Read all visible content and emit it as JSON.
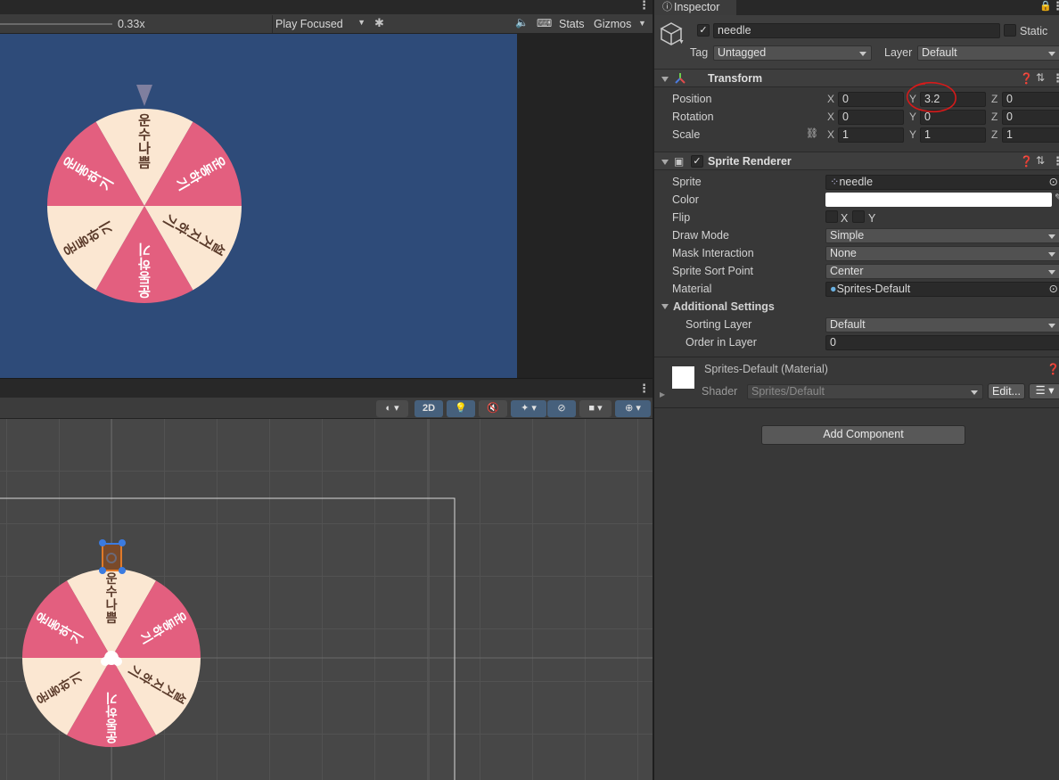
{
  "game_toolbar": {
    "scale_value": "0.33x",
    "play_mode": "Play Focused",
    "stats_label": "Stats",
    "gizmos_label": "Gizmos"
  },
  "wheel": {
    "segments": [
      {
        "text": "운수나쁨",
        "color": "#fbe7d2"
      },
      {
        "text": "운동하기",
        "color": "#e35f7f"
      },
      {
        "text": "설거지하기",
        "color": "#fbe7d2"
      },
      {
        "text": "운동하기",
        "color": "#e35f7f"
      },
      {
        "text": "운동하기",
        "color": "#fbe7d2"
      },
      {
        "text": "운동하기",
        "color": "#e35f7f"
      }
    ],
    "needle_color": "#7f7f9f"
  },
  "scene_toolbar": {
    "mode_2d": "2D"
  },
  "inspector": {
    "tab_label": "Inspector",
    "object_name": "needle",
    "static_label": "Static",
    "tag_label": "Tag",
    "tag_value": "Untagged",
    "layer_label": "Layer",
    "layer_value": "Default",
    "transform": {
      "title": "Transform",
      "rows": [
        {
          "label": "Position",
          "x": "0",
          "y": "3.2",
          "z": "0"
        },
        {
          "label": "Rotation",
          "x": "0",
          "y": "0",
          "z": "0"
        },
        {
          "label": "Scale",
          "x": "1",
          "y": "1",
          "z": "1"
        }
      ],
      "axis_x": "X",
      "axis_y": "Y",
      "axis_z": "Z"
    },
    "sprite_renderer": {
      "title": "Sprite Renderer",
      "sprite_label": "Sprite",
      "sprite_value": "needle",
      "color_label": "Color",
      "color_value": "#ffffff",
      "flip_label": "Flip",
      "flip_x": "X",
      "flip_y": "Y",
      "draw_mode_label": "Draw Mode",
      "draw_mode_value": "Simple",
      "mask_label": "Mask Interaction",
      "mask_value": "None",
      "sort_point_label": "Sprite Sort Point",
      "sort_point_value": "Center",
      "material_label": "Material",
      "material_value": "Sprites-Default",
      "additional_label": "Additional Settings",
      "sorting_layer_label": "Sorting Layer",
      "sorting_layer_value": "Default",
      "order_label": "Order in Layer",
      "order_value": "0"
    },
    "material": {
      "title": "Sprites-Default (Material)",
      "shader_label": "Shader",
      "shader_value": "Sprites/Default",
      "edit_label": "Edit..."
    },
    "add_component": "Add Component"
  }
}
